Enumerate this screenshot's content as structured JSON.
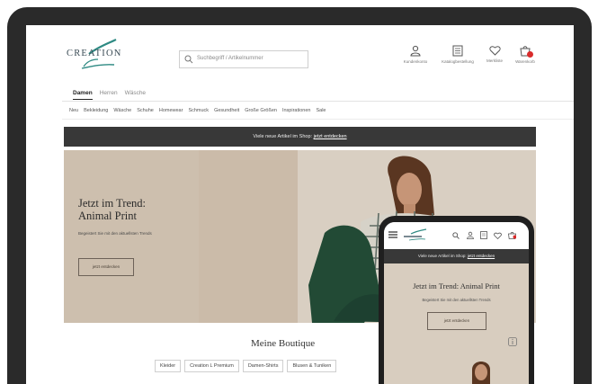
{
  "brand": {
    "name": "CREATION",
    "accent": "#2e8a83",
    "dark": "#383838"
  },
  "header": {
    "search_placeholder": "Suchbegriff / Artikelnummer",
    "icons": [
      {
        "name": "user-icon",
        "label": "Kundenkonto"
      },
      {
        "name": "catalog-icon",
        "label": "Katalogbestellung"
      },
      {
        "name": "heart-icon",
        "label": "Merkliste"
      },
      {
        "name": "bag-icon",
        "label": "Warenkorb"
      }
    ]
  },
  "gender_tabs": [
    "Damen",
    "Herren",
    "Wäsche"
  ],
  "category_nav": [
    "Neu",
    "Bekleidung",
    "Wäsche",
    "Schuhe",
    "Homewear",
    "Schmuck",
    "Gesundheit",
    "Große Größen",
    "Inspirationen",
    "Sale"
  ],
  "promo": {
    "text": "Viele neue Artikel im Shop:",
    "link": "jetzt entdecken"
  },
  "hero": {
    "title_line1": "Jetzt im Trend:",
    "title_line2": "Animal Print",
    "subtitle": "Begeistert Sie mit den aktuellsten Trends",
    "button": "jetzt entdecken"
  },
  "boutique": {
    "title": "Meine Boutique",
    "chips": [
      "Kleider",
      "Creation L Premium",
      "Damen-Shirts",
      "Blusen & Tuniken"
    ]
  },
  "mobile": {
    "promo_text": "Viele neue Artikel im Shop:",
    "promo_link": "jetzt entdecken",
    "title": "Jetzt im Trend: Animal Print",
    "subtitle": "Begeistert Sie mit den aktuellsten Trends",
    "button": "jetzt entdecken"
  }
}
